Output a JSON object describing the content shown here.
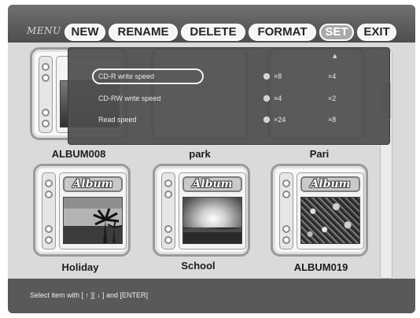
{
  "menu": {
    "label": "MENU",
    "items": [
      {
        "label": "NEW"
      },
      {
        "label": "RENAME"
      },
      {
        "label": "DELETE"
      },
      {
        "label": "FORMAT"
      },
      {
        "label": "SET",
        "selected": true
      },
      {
        "label": "EXIT"
      }
    ]
  },
  "albums": [
    {
      "name": "ALBUM008"
    },
    {
      "name": "park"
    },
    {
      "name": "Pari"
    },
    {
      "name": "Holiday",
      "cover_title": "Album"
    },
    {
      "name": "School",
      "cover_title": "Album"
    },
    {
      "name": "ALBUM019",
      "cover_title": "Album"
    }
  ],
  "settings_popup": {
    "header_mark": "▲",
    "rows": [
      {
        "label": "CD-R write speed",
        "options": [
          "×8",
          "×4"
        ],
        "selected_option": "×8",
        "focused": true
      },
      {
        "label": "CD-RW write speed",
        "options": [
          "×4",
          "×2"
        ],
        "selected_option": "×4"
      },
      {
        "label": "Read speed",
        "options": [
          "×24",
          "×8"
        ],
        "selected_option": "×24"
      }
    ]
  },
  "status_bar": {
    "text": "Select item with [ ↑ ][ ↓ ] and [ENTER]"
  },
  "colors": {
    "menubar": "#5e5e5e",
    "menu_button": "#f6f6f6",
    "menu_button_selected": "#a9a9a9",
    "popup_bg": "#4e4e4e",
    "statusbar": "#595959",
    "background": "#dadada"
  },
  "icons": {
    "radio": "radio-button-icon",
    "binder_ring": "binder-ring-icon"
  }
}
